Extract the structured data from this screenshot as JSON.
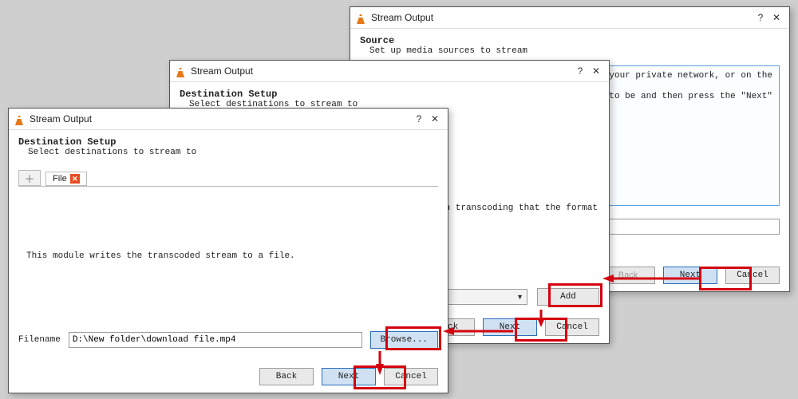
{
  "common": {
    "window_title": "Stream Output",
    "help_label": "?",
    "close_label": "✕",
    "back_label": "Back",
    "next_label": "Next",
    "cancel_label": "Cancel"
  },
  "win1": {
    "section_title": "Source",
    "section_sub": "Set up media sources to stream",
    "info_line1": "lcally, on your private network, or on the",
    "info_line2": "input to be and then press the \"Next\""
  },
  "win2": {
    "section_title": "Destination Setup",
    "section_sub": "Select destinations to stream to",
    "hint": "e to check with transcoding that the format",
    "add_label": "Add"
  },
  "win3": {
    "section_title": "Destination Setup",
    "section_sub": "Select destinations to stream to",
    "tab_label": "File",
    "description": "This module writes the transcoded stream to a file.",
    "filename_label": "Filename",
    "filename_value": "D:\\New folder\\download file.mp4",
    "browse_label": "Browse..."
  }
}
